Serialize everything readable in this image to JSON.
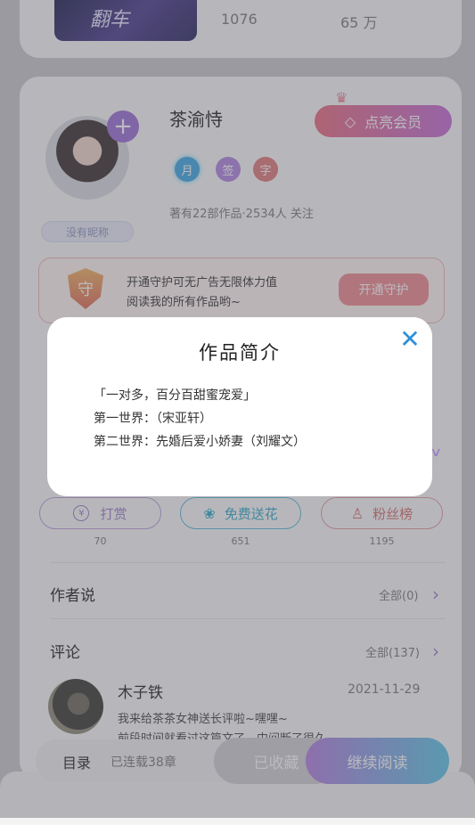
{
  "top_card": {
    "stat1": "1076",
    "stat2": "65 万",
    "cover_text": "翻车"
  },
  "author": {
    "name": "茶渝恃",
    "badges": [
      "月",
      "签",
      "字"
    ],
    "stats": "著有22部作品·2534人 关注",
    "vip_button": "点亮会员",
    "title_tag": "没有昵称"
  },
  "guard": {
    "icon_char": "守",
    "text_line1": "开通守护可无广告无限体力值",
    "text_line2": "阅读我的所有作品哟~",
    "button": "开通守护"
  },
  "actions": [
    {
      "label": "打赏",
      "count": "70",
      "color": "#9b7cc7"
    },
    {
      "label": "免费送花",
      "count": "651",
      "color": "#2fa7c8"
    },
    {
      "label": "粉丝榜",
      "count": "1195",
      "color": "#d36b6b"
    }
  ],
  "author_says": {
    "title": "作者说",
    "all": "全部(0)"
  },
  "comments": {
    "title": "评论",
    "all": "全部(137)",
    "items": [
      {
        "user": "木子铁",
        "date": "2021-11-29",
        "line1": "我来给茶茶女神送长评啦~嘿嘿~",
        "line2": "前段时间就看过这篇文了，中间断了很久"
      }
    ]
  },
  "bottom_bar": {
    "catalog": "目录",
    "serial": "已连载38章",
    "collected": "已收藏",
    "continue": "继续阅读"
  },
  "modal": {
    "title": "作品简介",
    "lines": [
      "「一对多，百分百甜蜜宠爱」",
      "第一世界：（宋亚轩）",
      "第二世界：先婚后爱小娇妻（刘耀文）"
    ]
  }
}
